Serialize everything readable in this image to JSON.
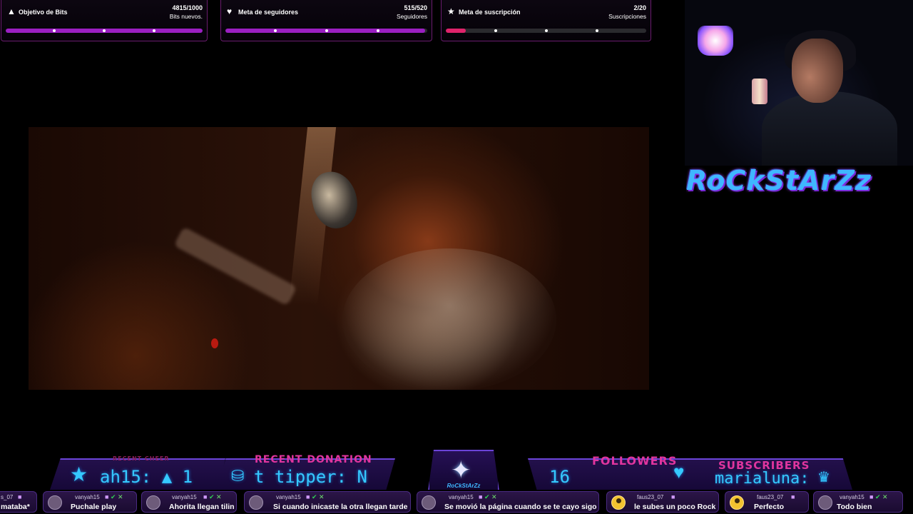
{
  "goals": [
    {
      "icon": "bits-icon",
      "glyph": "▲",
      "title": "Objetivo de Bits",
      "count": "4815/1000",
      "sub": "Bits nuevos.",
      "progress": 1.0,
      "fill": "#9b1fc2"
    },
    {
      "icon": "heart-icon",
      "glyph": "♥",
      "title": "Meta de seguidores",
      "count": "515/520",
      "sub": "Seguidores",
      "progress": 0.99,
      "fill": "#9b1fc2"
    },
    {
      "icon": "star-icon",
      "glyph": "★",
      "title": "Meta de suscripción",
      "count": "2/20",
      "sub": "Suscripciones",
      "progress": 0.1,
      "fill": "#e0236b"
    }
  ],
  "brand": "RoCkStArZz",
  "hud": {
    "recent_cheer_label": "RECENT CHEER",
    "recent_cheer_value": "ah15: ▲ 1",
    "recent_donation_label": "RECENT DONATION",
    "recent_donation_value": "t tipper: N",
    "logo_text": "RoCkStArZz",
    "followers_label": "FOLLOWERS",
    "followers_value": "16",
    "subscribers_label": "SUBSCRIBERS",
    "subscribers_value": "marialuna:"
  },
  "chat": [
    {
      "user": "s_07",
      "text": "mataba*",
      "avatar": "none"
    },
    {
      "user": "vanyah15",
      "text": "Puchale play",
      "avatar": "grey"
    },
    {
      "user": "vanyah15",
      "text": "Ahorita llegan tilin",
      "avatar": "grey"
    },
    {
      "user": "vanyah15",
      "text": "Si cuando inicaste la otra llegan tarde",
      "avatar": "grey"
    },
    {
      "user": "vanyah15",
      "text": "Se movió la página cuando se te cayo sigo",
      "avatar": "grey"
    },
    {
      "user": "faus23_07",
      "text": "le subes un poco Rock",
      "avatar": "gold"
    },
    {
      "user": "faus23_07",
      "text": "Perfecto",
      "avatar": "gold"
    },
    {
      "user": "vanyah15",
      "text": "Todo bien",
      "avatar": "grey"
    }
  ],
  "colors": {
    "accent_purple": "#9b1fc2",
    "accent_pink": "#e0236b",
    "hud_cyan": "#35c9ff",
    "hud_magenta": "#e0359e"
  }
}
